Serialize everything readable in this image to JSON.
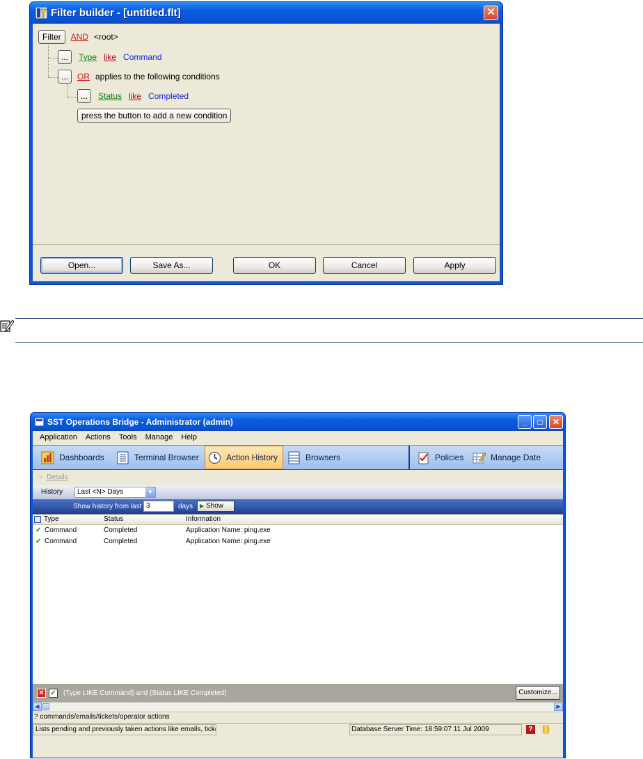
{
  "filter_builder": {
    "title": "Filter builder - [untitled.flt]",
    "close_glyph": "✕",
    "tree": {
      "root_button": "Filter",
      "root_operator": "AND",
      "root_label": "<root>",
      "row1": {
        "button": "...",
        "field": "Type",
        "op": "like",
        "value": "Command"
      },
      "row2": {
        "button": "...",
        "operator": "OR",
        "text": "applies to the following conditions"
      },
      "row3": {
        "button": "...",
        "field": "Status",
        "op": "like",
        "value": "Completed"
      },
      "add_condition": "press the button to add a new condition"
    },
    "buttons": {
      "open": "Open...",
      "save_as": "Save As...",
      "ok": "OK",
      "cancel": "Cancel",
      "apply": "Apply"
    }
  },
  "sst": {
    "title": "SST Operations Bridge - Administrator (admin)",
    "window_buttons": {
      "minimize": "_",
      "maximize": "□",
      "close": "✕"
    },
    "menu": [
      "Application",
      "Actions",
      "Tools",
      "Manage",
      "Help"
    ],
    "tabs": {
      "dashboards": "Dashboards",
      "terminal_browser": "Terminal Browser",
      "action_history": "Action History",
      "browsers": "Browsers",
      "policies": "Policies",
      "manage_data": "Manage Date"
    },
    "details_label": "Details",
    "history_label": "History",
    "history_select": "Last <N> Days",
    "show_label": "Show history from last",
    "days_value": "3",
    "days_label": "days",
    "show_button": "Show",
    "columns": [
      "Type",
      "Status",
      "Information"
    ],
    "rows": [
      {
        "type": "Command",
        "status": "Completed",
        "information": "Application Name: ping.exe"
      },
      {
        "type": "Command",
        "status": "Completed",
        "information": "Application Name: ping.exe"
      }
    ],
    "filter_text": "(Type LIKE Command) and (Status LIKE Completed)",
    "customize_button": "Customize...",
    "description": "? commands/emails/tickets/operator actions",
    "status_left": "Lists pending and previously taken actions like emails, ticket",
    "status_time": "Database Server Time: 18:59:07 11 Jul 2009",
    "colors": {
      "xp_blue": "#0a56d8",
      "tab_active": "#fdc974",
      "link_red": "#e01414",
      "link_green": "#108010",
      "link_blue": "#1428d8"
    }
  }
}
